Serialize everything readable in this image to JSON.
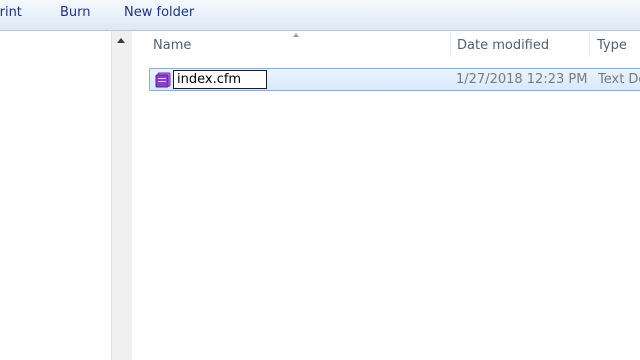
{
  "toolbar": {
    "print_label": "Print",
    "burn_label": "Burn",
    "new_folder_label": "New folder"
  },
  "columns": {
    "name": "Name",
    "date_modified": "Date modified",
    "type": "Type"
  },
  "files": [
    {
      "name": "index.cfm",
      "date_modified": "1/27/2018 12:23 PM",
      "type": "Text Do",
      "icon": "cfm-file-icon",
      "renaming": true
    }
  ],
  "colors": {
    "toolbar_text": "#1e3287",
    "header_text": "#4c607a",
    "selection_fill": "#d7e9fc",
    "selection_border": "#84acdd",
    "icon_purple": "#8a3fd1"
  }
}
